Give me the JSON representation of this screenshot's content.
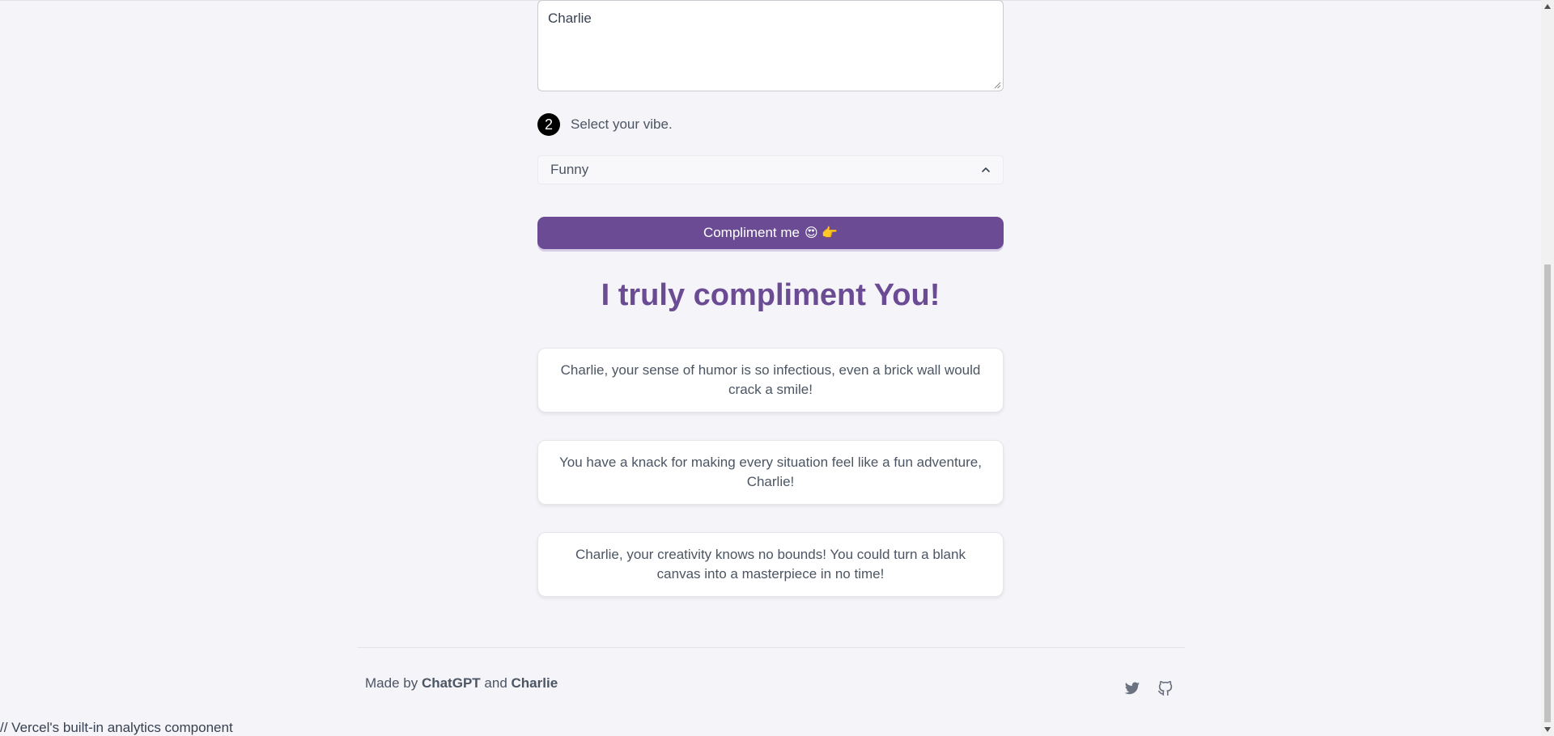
{
  "form": {
    "name_value": "Charlie",
    "step_number": "2",
    "step_label": "Select your vibe.",
    "vibe_selected": "Funny",
    "button_label": "Compliment me",
    "button_emoji": "😍 👉"
  },
  "results": {
    "heading": "I truly compliment You!",
    "compliments": [
      "Charlie, your sense of humor is so infectious, even a brick wall would crack a smile!",
      "You have a knack for making every situation feel like a fun adventure, Charlie!",
      "Charlie, your creativity knows no bounds! You could turn a blank canvas into a masterpiece in no time!"
    ]
  },
  "footer": {
    "made_by": "Made by",
    "author1": "ChatGPT",
    "and": "and",
    "author2": "Charlie",
    "icons": [
      "twitter-icon",
      "github-icon"
    ]
  },
  "analytics_note": "// Vercel's built-in analytics component",
  "colors": {
    "accent": "#6b4c94",
    "background": "#f5f4f8"
  }
}
